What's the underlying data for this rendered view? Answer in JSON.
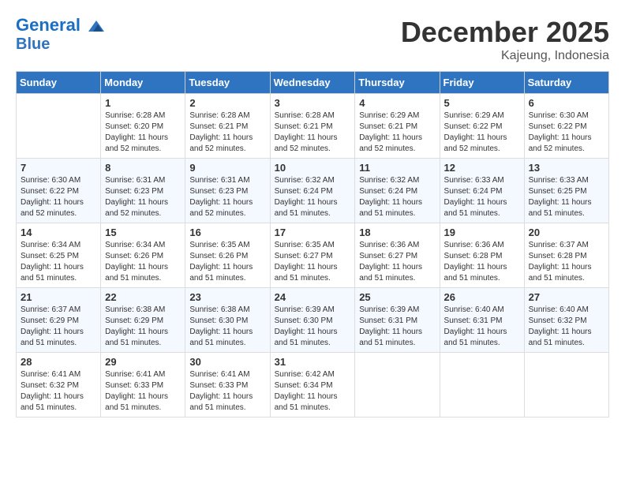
{
  "header": {
    "logo_line1": "General",
    "logo_line2": "Blue",
    "month_title": "December 2025",
    "location": "Kajeung, Indonesia"
  },
  "days_of_week": [
    "Sunday",
    "Monday",
    "Tuesday",
    "Wednesday",
    "Thursday",
    "Friday",
    "Saturday"
  ],
  "weeks": [
    [
      {
        "num": "",
        "sunrise": "",
        "sunset": "",
        "daylight": ""
      },
      {
        "num": "1",
        "sunrise": "Sunrise: 6:28 AM",
        "sunset": "Sunset: 6:20 PM",
        "daylight": "Daylight: 11 hours and 52 minutes."
      },
      {
        "num": "2",
        "sunrise": "Sunrise: 6:28 AM",
        "sunset": "Sunset: 6:21 PM",
        "daylight": "Daylight: 11 hours and 52 minutes."
      },
      {
        "num": "3",
        "sunrise": "Sunrise: 6:28 AM",
        "sunset": "Sunset: 6:21 PM",
        "daylight": "Daylight: 11 hours and 52 minutes."
      },
      {
        "num": "4",
        "sunrise": "Sunrise: 6:29 AM",
        "sunset": "Sunset: 6:21 PM",
        "daylight": "Daylight: 11 hours and 52 minutes."
      },
      {
        "num": "5",
        "sunrise": "Sunrise: 6:29 AM",
        "sunset": "Sunset: 6:22 PM",
        "daylight": "Daylight: 11 hours and 52 minutes."
      },
      {
        "num": "6",
        "sunrise": "Sunrise: 6:30 AM",
        "sunset": "Sunset: 6:22 PM",
        "daylight": "Daylight: 11 hours and 52 minutes."
      }
    ],
    [
      {
        "num": "7",
        "sunrise": "Sunrise: 6:30 AM",
        "sunset": "Sunset: 6:22 PM",
        "daylight": "Daylight: 11 hours and 52 minutes."
      },
      {
        "num": "8",
        "sunrise": "Sunrise: 6:31 AM",
        "sunset": "Sunset: 6:23 PM",
        "daylight": "Daylight: 11 hours and 52 minutes."
      },
      {
        "num": "9",
        "sunrise": "Sunrise: 6:31 AM",
        "sunset": "Sunset: 6:23 PM",
        "daylight": "Daylight: 11 hours and 52 minutes."
      },
      {
        "num": "10",
        "sunrise": "Sunrise: 6:32 AM",
        "sunset": "Sunset: 6:24 PM",
        "daylight": "Daylight: 11 hours and 51 minutes."
      },
      {
        "num": "11",
        "sunrise": "Sunrise: 6:32 AM",
        "sunset": "Sunset: 6:24 PM",
        "daylight": "Daylight: 11 hours and 51 minutes."
      },
      {
        "num": "12",
        "sunrise": "Sunrise: 6:33 AM",
        "sunset": "Sunset: 6:24 PM",
        "daylight": "Daylight: 11 hours and 51 minutes."
      },
      {
        "num": "13",
        "sunrise": "Sunrise: 6:33 AM",
        "sunset": "Sunset: 6:25 PM",
        "daylight": "Daylight: 11 hours and 51 minutes."
      }
    ],
    [
      {
        "num": "14",
        "sunrise": "Sunrise: 6:34 AM",
        "sunset": "Sunset: 6:25 PM",
        "daylight": "Daylight: 11 hours and 51 minutes."
      },
      {
        "num": "15",
        "sunrise": "Sunrise: 6:34 AM",
        "sunset": "Sunset: 6:26 PM",
        "daylight": "Daylight: 11 hours and 51 minutes."
      },
      {
        "num": "16",
        "sunrise": "Sunrise: 6:35 AM",
        "sunset": "Sunset: 6:26 PM",
        "daylight": "Daylight: 11 hours and 51 minutes."
      },
      {
        "num": "17",
        "sunrise": "Sunrise: 6:35 AM",
        "sunset": "Sunset: 6:27 PM",
        "daylight": "Daylight: 11 hours and 51 minutes."
      },
      {
        "num": "18",
        "sunrise": "Sunrise: 6:36 AM",
        "sunset": "Sunset: 6:27 PM",
        "daylight": "Daylight: 11 hours and 51 minutes."
      },
      {
        "num": "19",
        "sunrise": "Sunrise: 6:36 AM",
        "sunset": "Sunset: 6:28 PM",
        "daylight": "Daylight: 11 hours and 51 minutes."
      },
      {
        "num": "20",
        "sunrise": "Sunrise: 6:37 AM",
        "sunset": "Sunset: 6:28 PM",
        "daylight": "Daylight: 11 hours and 51 minutes."
      }
    ],
    [
      {
        "num": "21",
        "sunrise": "Sunrise: 6:37 AM",
        "sunset": "Sunset: 6:29 PM",
        "daylight": "Daylight: 11 hours and 51 minutes."
      },
      {
        "num": "22",
        "sunrise": "Sunrise: 6:38 AM",
        "sunset": "Sunset: 6:29 PM",
        "daylight": "Daylight: 11 hours and 51 minutes."
      },
      {
        "num": "23",
        "sunrise": "Sunrise: 6:38 AM",
        "sunset": "Sunset: 6:30 PM",
        "daylight": "Daylight: 11 hours and 51 minutes."
      },
      {
        "num": "24",
        "sunrise": "Sunrise: 6:39 AM",
        "sunset": "Sunset: 6:30 PM",
        "daylight": "Daylight: 11 hours and 51 minutes."
      },
      {
        "num": "25",
        "sunrise": "Sunrise: 6:39 AM",
        "sunset": "Sunset: 6:31 PM",
        "daylight": "Daylight: 11 hours and 51 minutes."
      },
      {
        "num": "26",
        "sunrise": "Sunrise: 6:40 AM",
        "sunset": "Sunset: 6:31 PM",
        "daylight": "Daylight: 11 hours and 51 minutes."
      },
      {
        "num": "27",
        "sunrise": "Sunrise: 6:40 AM",
        "sunset": "Sunset: 6:32 PM",
        "daylight": "Daylight: 11 hours and 51 minutes."
      }
    ],
    [
      {
        "num": "28",
        "sunrise": "Sunrise: 6:41 AM",
        "sunset": "Sunset: 6:32 PM",
        "daylight": "Daylight: 11 hours and 51 minutes."
      },
      {
        "num": "29",
        "sunrise": "Sunrise: 6:41 AM",
        "sunset": "Sunset: 6:33 PM",
        "daylight": "Daylight: 11 hours and 51 minutes."
      },
      {
        "num": "30",
        "sunrise": "Sunrise: 6:41 AM",
        "sunset": "Sunset: 6:33 PM",
        "daylight": "Daylight: 11 hours and 51 minutes."
      },
      {
        "num": "31",
        "sunrise": "Sunrise: 6:42 AM",
        "sunset": "Sunset: 6:34 PM",
        "daylight": "Daylight: 11 hours and 51 minutes."
      },
      {
        "num": "",
        "sunrise": "",
        "sunset": "",
        "daylight": ""
      },
      {
        "num": "",
        "sunrise": "",
        "sunset": "",
        "daylight": ""
      },
      {
        "num": "",
        "sunrise": "",
        "sunset": "",
        "daylight": ""
      }
    ]
  ]
}
